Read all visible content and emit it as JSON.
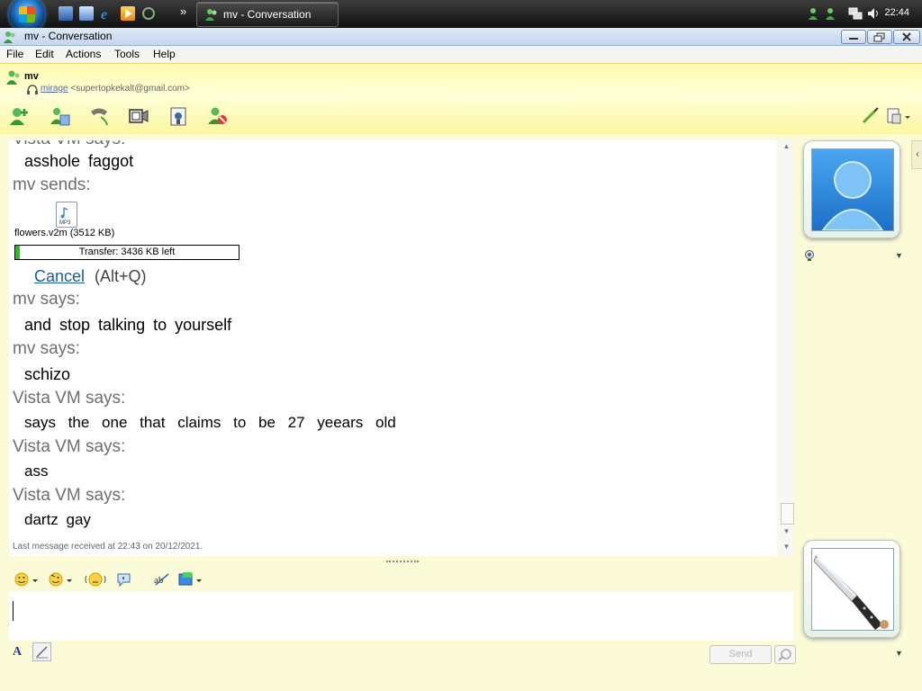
{
  "taskbar": {
    "window_button_label": "mv - Conversation",
    "clock": "22:44"
  },
  "window": {
    "title": "mv - Conversation"
  },
  "menu": [
    "File",
    "Edit",
    "Actions",
    "Tools",
    "Help"
  ],
  "contact": {
    "name": "mv",
    "nickname": "mirage",
    "email": "<supertopkekalt@gmail.com>"
  },
  "toolbar": {
    "icons": [
      "invite-contact-icon",
      "share-files-icon",
      "call-icon",
      "video-icon",
      "activities-icon",
      "block-icon",
      "paint-brush-icon",
      "display-options-icon"
    ]
  },
  "conversation": {
    "partial_header": "Vista VM says:",
    "items": [
      {
        "type": "text",
        "text": "asshole  faggot"
      },
      {
        "type": "header",
        "text": "mv sends:"
      },
      {
        "type": "header",
        "text": "mv says:"
      },
      {
        "type": "text",
        "text": "and stop talking to yourself"
      },
      {
        "type": "header",
        "text": "mv says:"
      },
      {
        "type": "text",
        "text": "schizo"
      },
      {
        "type": "header",
        "text": "Vista VM says:"
      },
      {
        "type": "text",
        "text": "says  the  one  that  claims  to  be  27  yeears  old"
      },
      {
        "type": "header",
        "text": "Vista VM says:"
      },
      {
        "type": "text",
        "text": "ass"
      },
      {
        "type": "header",
        "text": "Vista VM says:"
      },
      {
        "type": "text",
        "text": "dartz  gay"
      }
    ],
    "file_transfer": {
      "file_icon_label": "MP3",
      "file_name": "flowers.v2m (3512 KB)",
      "progress_label": "Transfer: 3436 KB left",
      "progress_fraction": 0.02,
      "cancel_label": "Cancel",
      "cancel_shortcut": "(Alt+Q)"
    },
    "last_message": "Last message received at 22:43 on 20/12/2021."
  },
  "input": {
    "value": "",
    "send_label": "Send",
    "font_label": "A"
  },
  "colors": {
    "header_yellow": "#fffbb0",
    "accent_blue": "#1a5ea8",
    "progress_green": "#25c025"
  }
}
